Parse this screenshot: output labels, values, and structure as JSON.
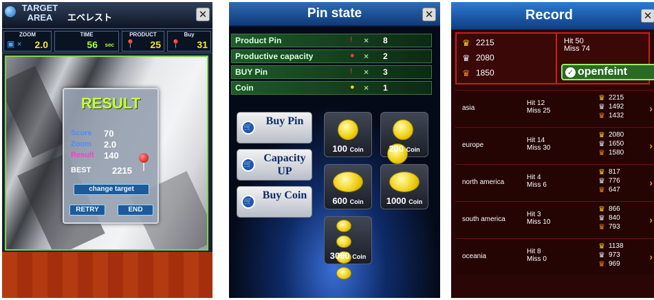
{
  "panel1": {
    "title": "TARGET AREA",
    "location": "エベレスト",
    "stats": {
      "zoom": {
        "label": "ZOOM",
        "value": "2.0"
      },
      "time": {
        "label": "TIME",
        "value": "56",
        "unit": "sec"
      },
      "product": {
        "label": "PRODUCT",
        "value": "25"
      },
      "buy": {
        "label": "Buy",
        "value": "31"
      }
    },
    "result": {
      "title": "RESULT",
      "score_label": "Score",
      "score": "70",
      "zoom_label": "Zoom",
      "zoom": "2.0",
      "result_label": "Result",
      "result": "140",
      "best_label": "BEST",
      "best": "2215",
      "change_target": "change target",
      "retry": "RETRY",
      "end": "END"
    }
  },
  "panel2": {
    "title": "Pin state",
    "rows": [
      {
        "label": "Product Pin",
        "value": "8"
      },
      {
        "label": "Productive capacity",
        "value": "2"
      },
      {
        "label": "BUY Pin",
        "value": "3"
      },
      {
        "label": "Coin",
        "value": "1"
      }
    ],
    "buy_buttons": {
      "buy_pin": "Buy Pin",
      "capacity_up": "Capacity UP",
      "buy_coin": "Buy Coin"
    },
    "coin_packs": [
      {
        "amount": "100",
        "unit": "Coin"
      },
      {
        "amount": "200",
        "unit": "Coin"
      },
      {
        "amount": "600",
        "unit": "Coin"
      },
      {
        "amount": "1000",
        "unit": "Coin"
      },
      {
        "amount": "3000",
        "unit": "Coin"
      }
    ]
  },
  "panel3": {
    "title": "Record",
    "top_scores": [
      "2215",
      "2080",
      "1850"
    ],
    "hit_label": "Hit",
    "hit": "50",
    "miss_label": "Miss",
    "miss": "74",
    "openfeint": "openfeint",
    "regions": [
      {
        "name": "asia",
        "hit": "12",
        "miss": "25",
        "scores": [
          "2215",
          "1492",
          "1432"
        ]
      },
      {
        "name": "europe",
        "hit": "14",
        "miss": "30",
        "scores": [
          "2080",
          "1650",
          "1580"
        ]
      },
      {
        "name": "north america",
        "hit": "4",
        "miss": "6",
        "scores": [
          "817",
          "776",
          "647"
        ]
      },
      {
        "name": "south america",
        "hit": "3",
        "miss": "10",
        "scores": [
          "866",
          "840",
          "793"
        ]
      },
      {
        "name": "oceania",
        "hit": "8",
        "miss": "0",
        "scores": [
          "1138",
          "973",
          "969"
        ]
      }
    ]
  },
  "colors": {
    "accent_blue": "#1e56b4",
    "result_green": "#c8ff3a",
    "record_red": "#c81e1e",
    "coin_gold": "#f1d21a"
  }
}
